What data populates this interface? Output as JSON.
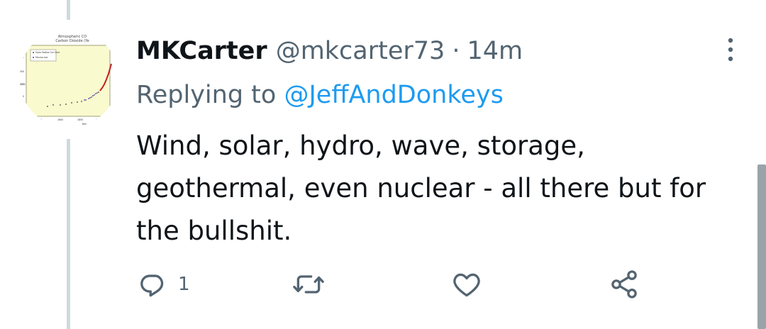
{
  "tweet": {
    "display_name": "MKCarter",
    "handle": "@mkcarter73",
    "separator": "·",
    "time": "14m",
    "replying_prefix": "Replying to",
    "replying_to": "@JeffAndDonkeys",
    "text": "Wind, solar, hydro, wave, storage, geothermal, even nuclear - all there but for the bullshit.",
    "reply_count": "1",
    "retweet_count": "",
    "like_count": ""
  },
  "avatar": {
    "description_icon": "co2-chart-avatar",
    "title_lines": [
      "Atmospheric CO",
      "Carbon Dioxide (Ye"
    ],
    "legend": [
      "Siple Station Ice Core",
      "Mauna Loa"
    ],
    "y_ticks": [
      "375",
      "350",
      "325",
      "300",
      "275"
    ],
    "y_label": "CO2",
    "x_ticks": [
      "1750",
      "1800",
      "1850",
      "1900"
    ],
    "x_label": "Year"
  },
  "colors": {
    "text_primary": "#0f1419",
    "text_secondary": "#536471",
    "link": "#1d9bf0",
    "thread_line": "#cfd9de",
    "icon": "#536471"
  }
}
